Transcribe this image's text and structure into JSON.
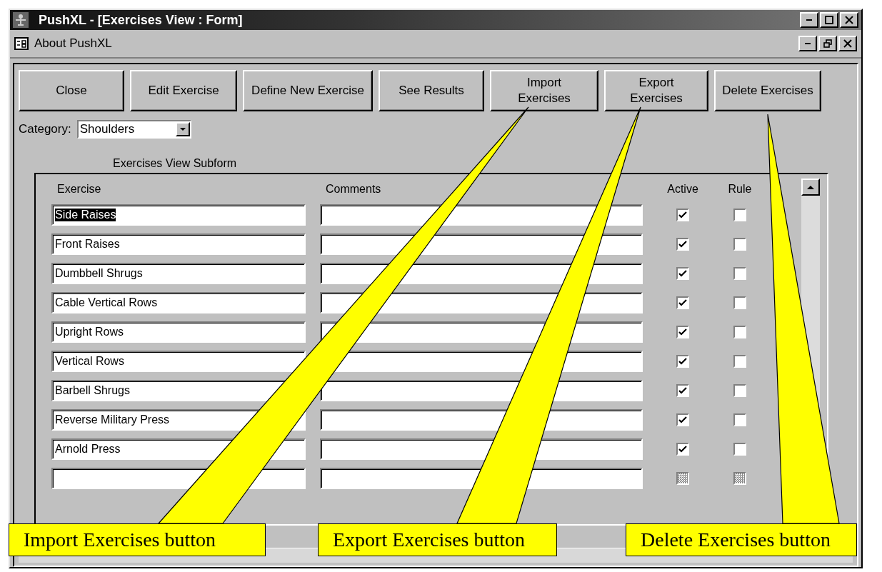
{
  "window": {
    "title": "PushXL - [Exercises View : Form]"
  },
  "menu_bar": {
    "label": "About PushXL"
  },
  "buttons": [
    {
      "label": "Close"
    },
    {
      "label": "Edit Exercise"
    },
    {
      "label": "Define New Exercise"
    },
    {
      "label": "See Results"
    },
    {
      "label": "Import\nExercises"
    },
    {
      "label": "Export\nExercises"
    },
    {
      "label": "Delete Exercises"
    }
  ],
  "category": {
    "label": "Category:",
    "value": "Shoulders"
  },
  "subform": {
    "title": "Exercises View Subform",
    "columns": [
      "Exercise",
      "Comments",
      "Active",
      "Rule"
    ],
    "rows": [
      {
        "kind": "record",
        "exercise": "Side Raises",
        "selected": true,
        "active": true,
        "rule": false
      },
      {
        "kind": "record",
        "exercise": "Front Raises",
        "selected": false,
        "active": true,
        "rule": false
      },
      {
        "kind": "record",
        "exercise": "Dumbbell Shrugs",
        "selected": false,
        "active": true,
        "rule": false
      },
      {
        "kind": "record",
        "exercise": "Cable Vertical Rows",
        "selected": false,
        "active": true,
        "rule": false
      },
      {
        "kind": "record",
        "exercise": "Upright Rows",
        "selected": false,
        "active": true,
        "rule": false
      },
      {
        "kind": "record",
        "exercise": "Vertical Rows",
        "selected": false,
        "active": true,
        "rule": false
      },
      {
        "kind": "record",
        "exercise": "Barbell Shrugs",
        "selected": false,
        "active": true,
        "rule": false
      },
      {
        "kind": "record",
        "exercise": "Reverse Military Press",
        "selected": false,
        "active": true,
        "rule": false
      },
      {
        "kind": "record",
        "exercise": "Arnold Press",
        "selected": false,
        "active": true,
        "rule": false
      },
      {
        "kind": "new"
      }
    ]
  },
  "callouts": [
    {
      "text": "Import Exercises button"
    },
    {
      "text": "Export Exercises button"
    },
    {
      "text": "Delete Exercises button"
    }
  ]
}
